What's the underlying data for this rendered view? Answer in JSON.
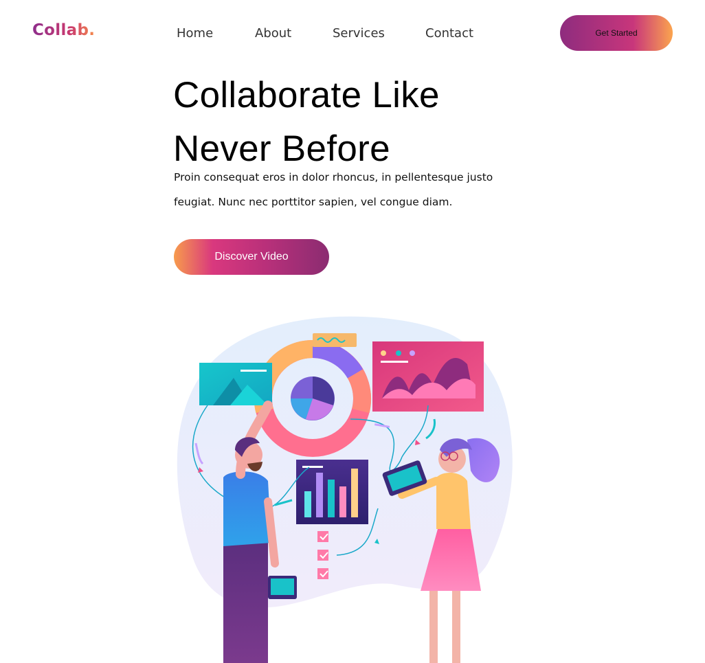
{
  "brand": {
    "name": "Collab."
  },
  "nav": {
    "items": [
      {
        "label": "Home"
      },
      {
        "label": "About"
      },
      {
        "label": "Services"
      },
      {
        "label": "Contact"
      }
    ],
    "cta_label": "Get Started"
  },
  "hero": {
    "title": "Collaborate Like Never Before",
    "subtitle": "Proin consequat eros in dolor rhoncus, in pellentesque justo feugiat. Nunc nec porttitor sapien, vel congue diam.",
    "video_button_label": "Discover Video"
  },
  "theme": {
    "primary_gradient": [
      "#8e2c7e",
      "#c8367b",
      "#fba44e"
    ],
    "accent_teal": "#19c2c9",
    "accent_purple": "#7b61d6",
    "accent_pink": "#f0508a"
  },
  "illustration": {
    "description_icon": "team-collaboration-illustration"
  }
}
